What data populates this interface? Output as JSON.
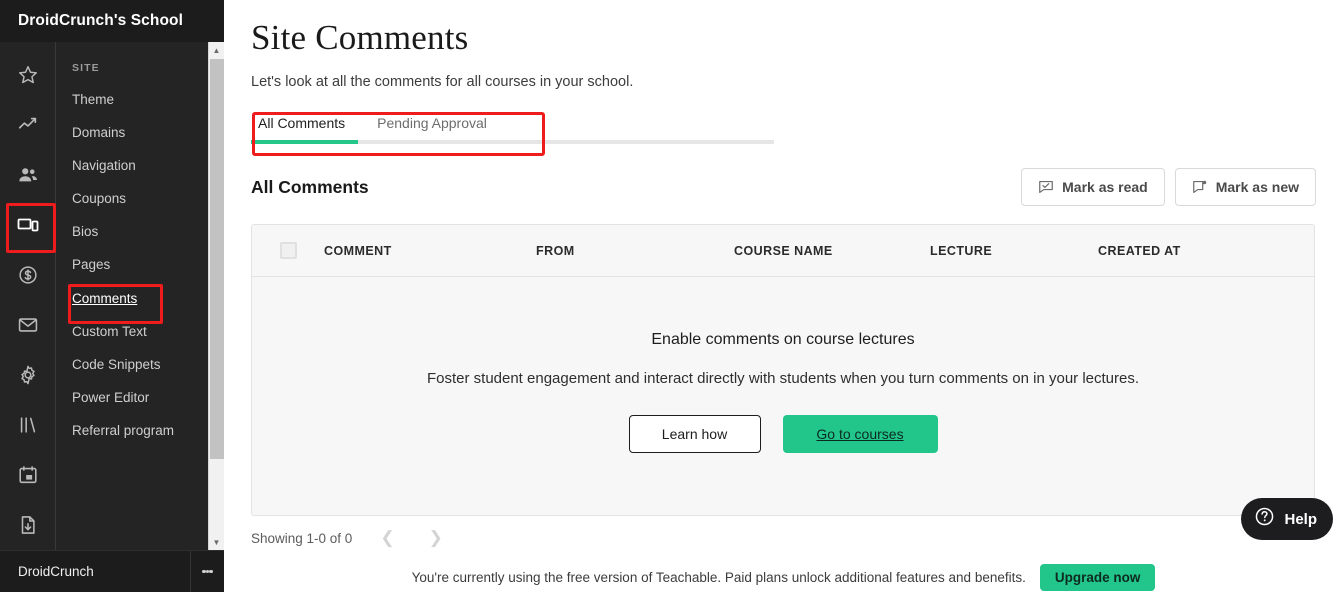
{
  "brand": {
    "title": "DroidCrunch's School"
  },
  "rail": {
    "items": [
      {
        "icon": "star-icon",
        "name": "rail-item-favorites",
        "active": false
      },
      {
        "icon": "analytics-icon",
        "name": "rail-item-analytics",
        "active": false
      },
      {
        "icon": "users-icon",
        "name": "rail-item-users",
        "active": false
      },
      {
        "icon": "site-devices-icon",
        "name": "rail-item-site",
        "active": true
      },
      {
        "icon": "dollar-circle-icon",
        "name": "rail-item-sales",
        "active": false
      },
      {
        "icon": "mail-icon",
        "name": "rail-item-emails",
        "active": false
      },
      {
        "icon": "gear-icon",
        "name": "rail-item-settings",
        "active": false
      },
      {
        "icon": "library-icon",
        "name": "rail-item-library",
        "active": false
      },
      {
        "icon": "calendar-icon",
        "name": "rail-item-calendar",
        "active": false
      },
      {
        "icon": "file-download-icon",
        "name": "rail-item-reports",
        "active": false
      },
      {
        "icon": "shapes-icon",
        "name": "rail-item-apps",
        "active": false
      }
    ]
  },
  "subnav": {
    "heading": "SITE",
    "items": [
      {
        "label": "Theme"
      },
      {
        "label": "Domains"
      },
      {
        "label": "Navigation"
      },
      {
        "label": "Coupons"
      },
      {
        "label": "Bios"
      },
      {
        "label": "Pages"
      },
      {
        "label": "Comments"
      },
      {
        "label": "Custom Text"
      },
      {
        "label": "Code Snippets"
      },
      {
        "label": "Power Editor"
      },
      {
        "label": "Referral program"
      }
    ],
    "current": "Comments"
  },
  "nav_footer": {
    "user": "DroidCrunch",
    "menu_icon": "kebab-menu-icon"
  },
  "page": {
    "title": "Site Comments",
    "subtitle": "Let's look at all the comments for all courses in your school."
  },
  "tabs": [
    {
      "label": "All Comments",
      "active": true
    },
    {
      "label": "Pending Approval",
      "active": false
    }
  ],
  "section": {
    "title": "All Comments",
    "actions": [
      {
        "label": "Mark as read",
        "icon": "comment-check-icon"
      },
      {
        "label": "Mark as new",
        "icon": "comment-dot-icon"
      }
    ]
  },
  "table": {
    "select_all_checkbox": "unchecked",
    "columns": [
      "COMMENT",
      "FROM",
      "COURSE NAME",
      "LECTURE",
      "CREATED AT"
    ],
    "rows": []
  },
  "empty_state": {
    "heading": "Enable comments on course lectures",
    "body": "Foster student engagement and interact directly with students when you turn comments on in your lectures.",
    "secondary_button": "Learn how",
    "primary_button": "Go to courses"
  },
  "pagination": {
    "summary": "Showing 1-0 of 0",
    "prev_icon": "chevron-left-icon",
    "next_icon": "chevron-right-icon"
  },
  "banner": {
    "text": "You're currently using the free version of Teachable. Paid plans unlock additional features and benefits.",
    "button": "Upgrade now"
  },
  "help_widget": {
    "label": "Help",
    "icon": "question-circle-icon"
  },
  "colors": {
    "accent_green": "#23c68a",
    "highlight_red": "#ee1c1c",
    "nav_dark": "#242424",
    "nav_dark_bar": "#1c1c1c",
    "table_bg": "#f7f7f7"
  }
}
